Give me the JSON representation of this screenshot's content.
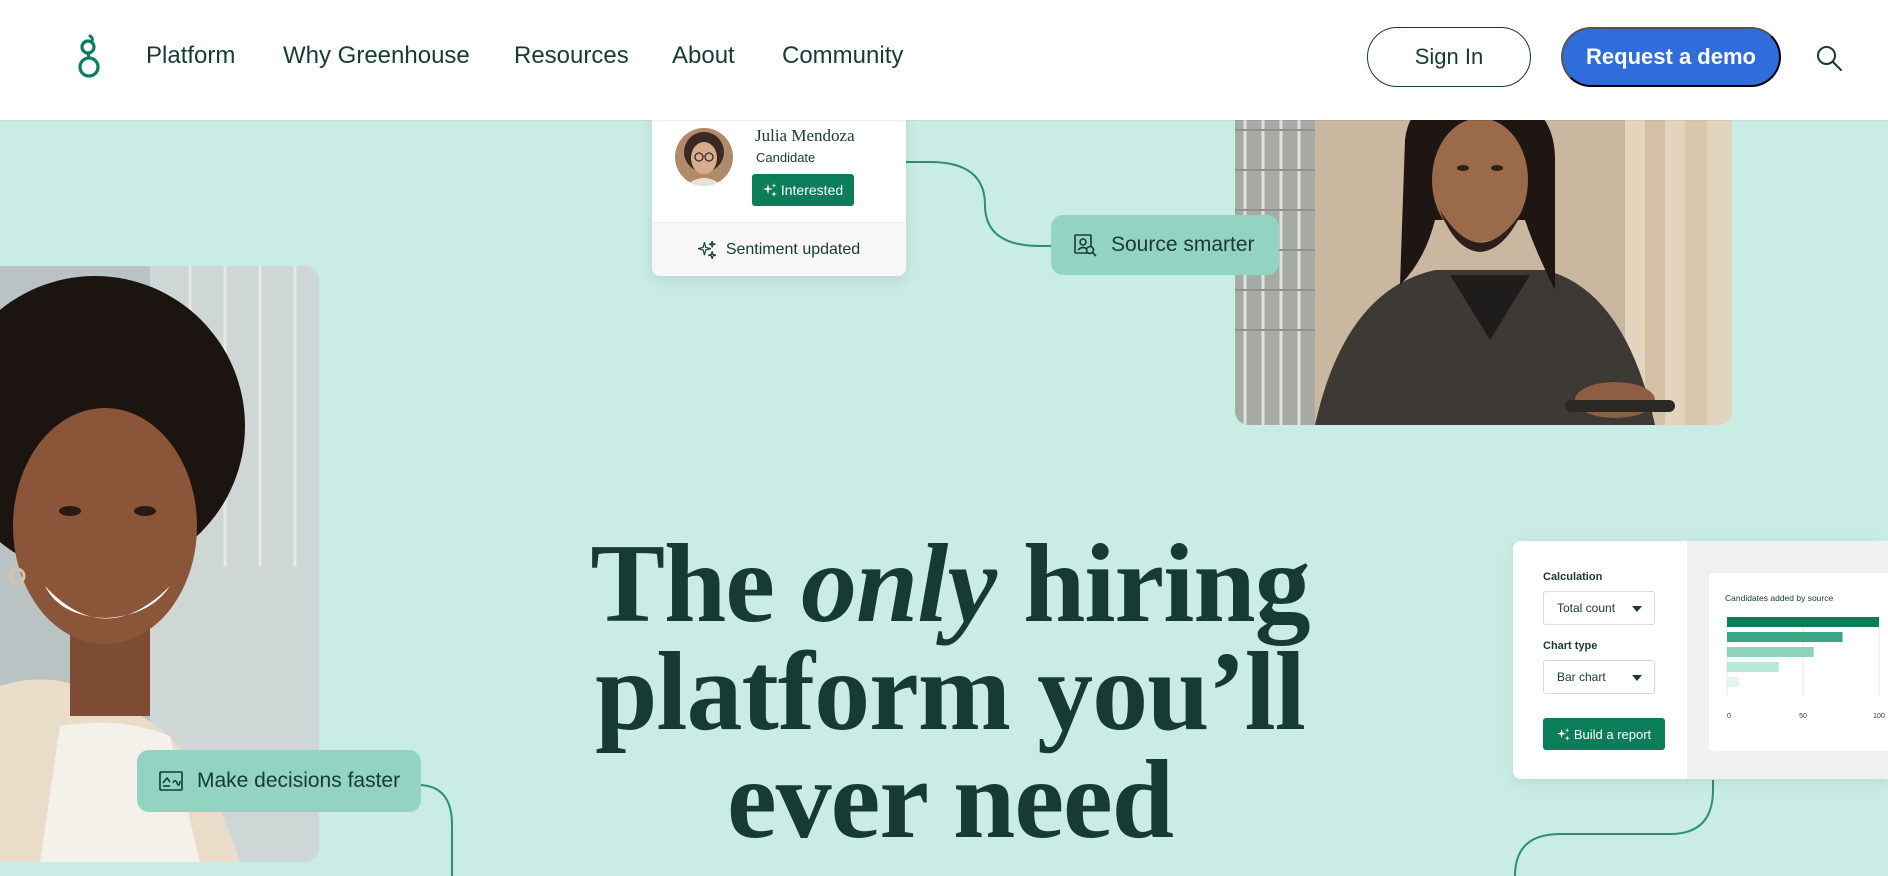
{
  "header": {
    "logo_icon": "greenhouse-g-logo",
    "nav": [
      {
        "label": "Platform"
      },
      {
        "label": "Why Greenhouse"
      },
      {
        "label": "Resources"
      },
      {
        "label": "About"
      },
      {
        "label": "Community"
      }
    ],
    "sign_in_label": "Sign In",
    "demo_label": "Request a demo",
    "search_icon": "search-icon"
  },
  "candidate_card": {
    "name": "Julia Mendoza",
    "role": "Candidate",
    "tag_label": "Interested",
    "footer_text": "Sentiment updated"
  },
  "pills": {
    "source": "Source smarter",
    "decisions": "Make decisions faster"
  },
  "headline": {
    "before": "The ",
    "emphasis": "only",
    "after": " hiring platform you’ll ever need"
  },
  "report_card": {
    "calculation_label": "Calculation",
    "calculation_value": "Total count",
    "chart_type_label": "Chart type",
    "chart_type_value": "Bar chart",
    "button_label": "Build a report"
  },
  "chart_data": {
    "type": "bar",
    "orientation": "horizontal",
    "title": "Candidates added by source",
    "categories": [
      "",
      "",
      "",
      "",
      ""
    ],
    "values": [
      100,
      76,
      57,
      34,
      8
    ],
    "xlim": [
      0,
      100
    ],
    "xticks": [
      "0",
      "50",
      "100"
    ],
    "colors": [
      "#0b7d59",
      "#3aa784",
      "#8fd3bd",
      "#b9e6d8",
      "#e3f5ef"
    ]
  },
  "colors": {
    "background": "#c9ede4",
    "brand_green": "#0b7d59",
    "pill_green": "#92d4c1",
    "demo_blue": "#2e6ddb",
    "text_dark": "#163b33"
  }
}
